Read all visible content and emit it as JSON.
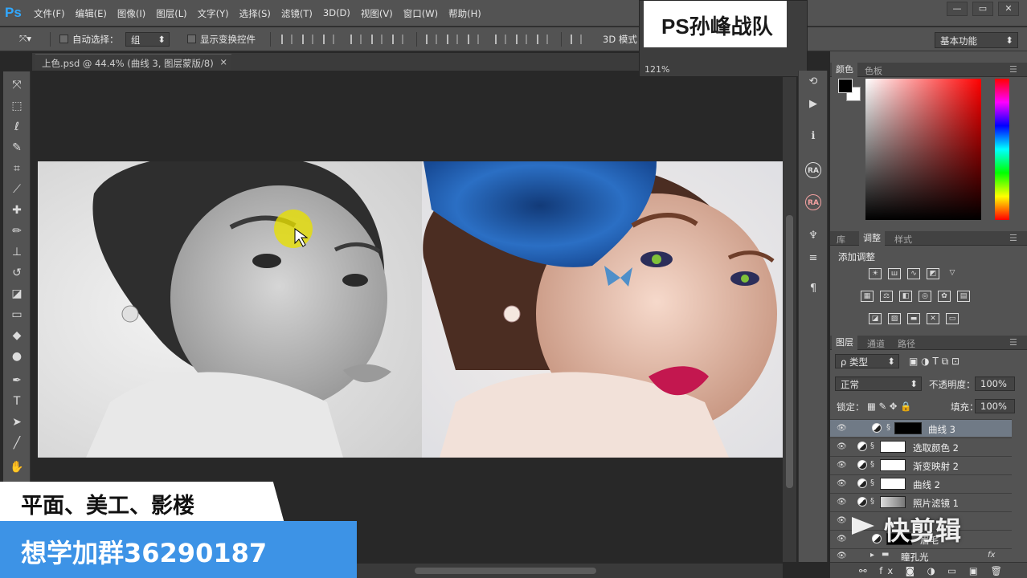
{
  "app": {
    "logo": "Ps",
    "menus": [
      "文件(F)",
      "编辑(E)",
      "图像(I)",
      "图层(L)",
      "文字(Y)",
      "选择(S)",
      "滤镜(T)",
      "3D(D)",
      "视图(V)",
      "窗口(W)",
      "帮助(H)"
    ],
    "window_controls": [
      "—",
      "▭",
      "✕"
    ]
  },
  "options": {
    "auto_select_label": "自动选择：",
    "auto_select_value": "组",
    "show_transform_label": "显示变换控件",
    "mode_3d_label": "3D 模式",
    "workspace": "基本功能"
  },
  "document": {
    "tab_title": "上色.psd @ 44.4% (曲线 3, 图层蒙版/8)",
    "close": "×"
  },
  "navigator": {
    "title": "PS孙峰战队",
    "zoom": "121%"
  },
  "panels": {
    "color_tabs": [
      "颜色",
      "色板"
    ],
    "adjust_tabs": [
      "库",
      "调整",
      "样式"
    ],
    "adjust_title": "添加调整",
    "layers_tabs": [
      "图层",
      "通道",
      "路径"
    ],
    "filter_kind": "ρ 类型",
    "blend_mode": "正常",
    "opacity_label": "不透明度：",
    "opacity_value": "100%",
    "lock_label": "锁定：",
    "fill_label": "填充：",
    "fill_value": "100%"
  },
  "layers": [
    {
      "name": "曲线 3",
      "mask": "black",
      "active": true
    },
    {
      "name": "选取颜色 2",
      "mask": "white",
      "active": false
    },
    {
      "name": "渐变映射 2",
      "mask": "white",
      "active": false
    },
    {
      "name": "曲线 2",
      "mask": "white",
      "active": false
    },
    {
      "name": "照片滤镜 1",
      "mask": "gray",
      "active": false
    },
    {
      "name": "",
      "mask": "none",
      "active": false
    },
    {
      "name": "眉毛",
      "mask": "black",
      "active": false
    },
    {
      "name": "瞳孔光",
      "mask": "folder",
      "active": false
    }
  ],
  "overlays": {
    "banner_line1": "平面、美工、影楼",
    "banner_line2": "想学加群36290187",
    "watermark": "快剪辑"
  },
  "colors": {
    "ui_dark": "#535353",
    "canvas_bg": "#282828",
    "accent_blue": "#3d93e6",
    "ps_blue": "#31a8ff",
    "layer_active": "#707a86"
  }
}
